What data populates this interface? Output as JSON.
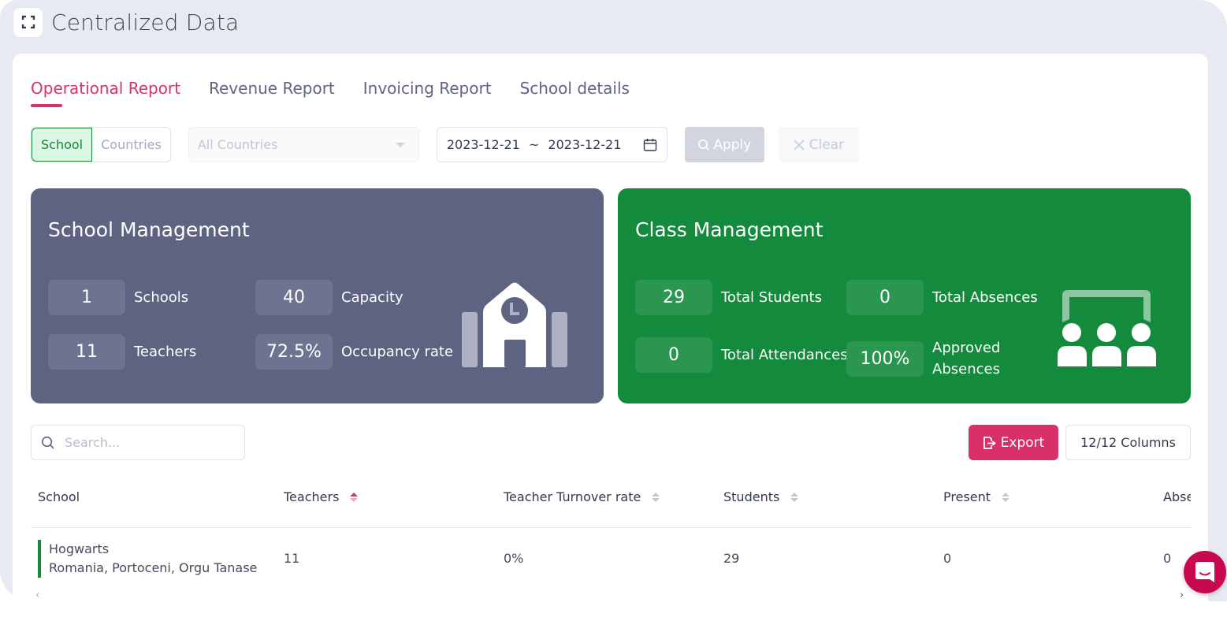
{
  "header": {
    "title": "Centralized Data",
    "expand_icon": "expand-icon"
  },
  "tabs": [
    {
      "label": "Operational Report",
      "active": true
    },
    {
      "label": "Revenue Report",
      "active": false
    },
    {
      "label": "Invoicing Report",
      "active": false
    },
    {
      "label": "School details",
      "active": false
    }
  ],
  "filters": {
    "segments": [
      {
        "label": "School",
        "active": true
      },
      {
        "label": "Countries",
        "active": false
      }
    ],
    "country_select": {
      "value": "All Countries",
      "placeholder": "All Countries"
    },
    "date_range": {
      "start": "2023-12-21",
      "separator": "~",
      "end": "2023-12-21"
    },
    "apply_label": "Apply",
    "clear_label": "Clear"
  },
  "school_management": {
    "title": "School Management",
    "color": "#5d6380",
    "stats": [
      {
        "value": "1",
        "label": "Schools"
      },
      {
        "value": "40",
        "label": "Capacity"
      },
      {
        "value": "11",
        "label": "Teachers"
      },
      {
        "value": "72.5%",
        "label": "Occupancy rate"
      }
    ]
  },
  "class_management": {
    "title": "Class Management",
    "color": "#138a3c",
    "stats": [
      {
        "value": "29",
        "label": "Total Students"
      },
      {
        "value": "0",
        "label": "Total Absences"
      },
      {
        "value": "0",
        "label": "Total Attendances"
      },
      {
        "value": "100%",
        "label": "Approved Absences"
      }
    ]
  },
  "toolbar": {
    "search_placeholder": "Search...",
    "search_value": "",
    "export_label": "Export",
    "export_color": "#d9306c",
    "columns_label": "12/12 Columns"
  },
  "table": {
    "columns": [
      {
        "label": "School",
        "sortable": false
      },
      {
        "label": "Teachers",
        "sortable": true,
        "sort_active": true
      },
      {
        "label": "Teacher Turnover rate",
        "sortable": true
      },
      {
        "label": "Students",
        "sortable": true
      },
      {
        "label": "Present",
        "sortable": true
      },
      {
        "label": "Abse",
        "sortable": false
      }
    ],
    "rows": [
      {
        "school_name": "Hogwarts",
        "school_location": "Romania, Portoceni, Orgu Tanase",
        "teachers": "11",
        "turnover": "0%",
        "students": "29",
        "present": "0",
        "absent": "0"
      }
    ]
  },
  "chat": {
    "icon": "chat-icon"
  }
}
